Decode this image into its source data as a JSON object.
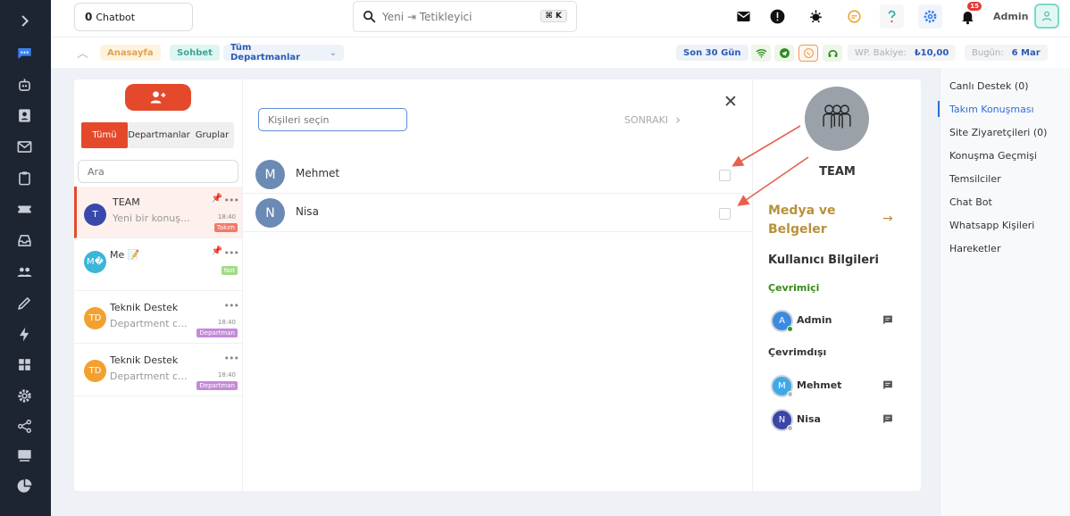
{
  "topbar": {
    "chatbot_count": "0",
    "chatbot_label": "Chatbot",
    "search_placeholder": "Yeni ⇥ Tetikleyici",
    "search_shortcut": "⌘ K",
    "notification_count": "15",
    "admin_name": "Admin"
  },
  "subbar": {
    "breadcrumb_home": "Anasayfa",
    "breadcrumb_chat": "Sohbet",
    "department_select": "Tüm Departmanlar",
    "date_range": "Son 30 Gün",
    "wp_balance_label": "WP. Bakiye:",
    "wp_balance_value": "₺10,00",
    "today_label": "Bugün:",
    "today_value": "6 Mar"
  },
  "chat_list": {
    "tabs": [
      "Tümü",
      "Departmanlar",
      "Gruplar"
    ],
    "search_placeholder": "Ara",
    "items": [
      {
        "initials": "T",
        "name": "TEAM",
        "message": "Yeni bir konuş...",
        "time": "18:40",
        "tag": "Takım"
      },
      {
        "initials": "M�",
        "name": "Me 📝",
        "message": "",
        "time": "",
        "tag": "Not"
      },
      {
        "initials": "TD",
        "name": "Teknik Destek",
        "message": "Department c...",
        "time": "18:40",
        "tag": "Departman"
      },
      {
        "initials": "TD",
        "name": "Teknik Destek",
        "message": "Department c...",
        "time": "18:40",
        "tag": "Departman"
      }
    ]
  },
  "middle": {
    "search_placeholder": "Kişileri seçin",
    "next_label": "SONRAKI",
    "people": [
      {
        "initial": "M",
        "name": "Mehmet"
      },
      {
        "initial": "N",
        "name": "Nisa"
      }
    ]
  },
  "team_panel": {
    "name": "TEAM",
    "media_label": "Medya ve Belgeler",
    "user_info_title": "Kullanıcı Bilgileri",
    "online_title": "Çevrimiçi",
    "offline_title": "Çevrimdışı",
    "online_members": [
      {
        "initial": "A",
        "name": "Admin"
      }
    ],
    "offline_members": [
      {
        "initial": "M",
        "name": "Mehmet"
      },
      {
        "initial": "N",
        "name": "Nisa"
      }
    ]
  },
  "right_nav": [
    "Canlı Destek (0)",
    "Takım Konuşması",
    "Site Ziyaretçileri (0)",
    "Konuşma Geçmişi",
    "Temsilciler",
    "Chat Bot",
    "Whatsapp Kişileri",
    "Hareketler"
  ],
  "colors": {
    "accent": "#e4492c",
    "sidebar": "#1d2532",
    "link": "#2f6fd3",
    "media": "#b8913a"
  }
}
